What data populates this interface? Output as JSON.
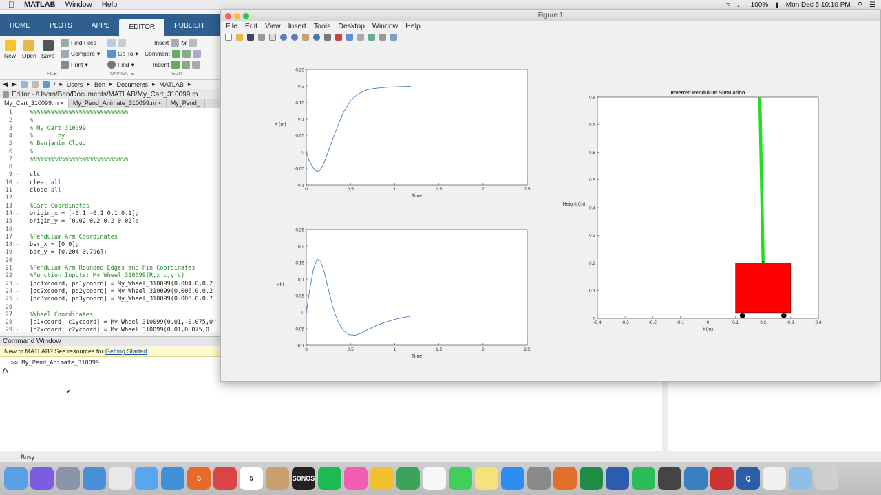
{
  "menubar": {
    "app": "MATLAB",
    "items": [
      "Window",
      "Help"
    ],
    "battery": "100%",
    "datetime": "Mon Dec 5  10:10 PM"
  },
  "toolstrip": {
    "tabs": [
      "HOME",
      "PLOTS",
      "APPS",
      "EDITOR",
      "PUBLISH"
    ],
    "active_tab": "EDITOR",
    "buttons": {
      "new": "New",
      "open": "Open",
      "save": "Save",
      "find_files": "Find Files",
      "compare": "Compare",
      "print": "Print",
      "go_to": "Go To",
      "find": "Find",
      "insert": "Insert",
      "comment": "Comment",
      "indent": "Indent",
      "fx": "fx"
    },
    "groups": {
      "file": "FILE",
      "navigate": "NAVIGATE",
      "edit": "EDIT"
    }
  },
  "address": {
    "crumbs": [
      "/",
      "Users",
      "Ben",
      "Documents",
      "MATLAB"
    ]
  },
  "editor": {
    "title": "Editor - /Users/Ben/Documents/MATLAB/My_Cart_310099.m",
    "tabs": [
      "My_Cart_310099.m",
      "My_Pend_Animate_310099.m",
      "My_Pend_"
    ],
    "lines": [
      {
        "n": "1",
        "d": "",
        "parts": [
          {
            "c": "cm",
            "t": "%%%%%%%%%%%%%%%%%%%%%%%%%%%%"
          }
        ]
      },
      {
        "n": "2",
        "d": "",
        "parts": [
          {
            "c": "cm",
            "t": "%"
          }
        ]
      },
      {
        "n": "3",
        "d": "",
        "parts": [
          {
            "c": "cm",
            "t": "% My_Cart_310099"
          }
        ]
      },
      {
        "n": "4",
        "d": "",
        "parts": [
          {
            "c": "cm",
            "t": "%       by"
          }
        ]
      },
      {
        "n": "5",
        "d": "",
        "parts": [
          {
            "c": "cm",
            "t": "% Benjamin Cloud"
          }
        ]
      },
      {
        "n": "6",
        "d": "",
        "parts": [
          {
            "c": "cm",
            "t": "%"
          }
        ]
      },
      {
        "n": "7",
        "d": "",
        "parts": [
          {
            "c": "cm",
            "t": "%%%%%%%%%%%%%%%%%%%%%%%%%%%%"
          }
        ]
      },
      {
        "n": "8",
        "d": "",
        "parts": []
      },
      {
        "n": "9",
        "d": "-",
        "parts": [
          {
            "c": "",
            "t": "clc"
          }
        ]
      },
      {
        "n": "10",
        "d": "-",
        "parts": [
          {
            "c": "",
            "t": "clear "
          },
          {
            "c": "kw",
            "t": "all"
          }
        ]
      },
      {
        "n": "11",
        "d": "-",
        "parts": [
          {
            "c": "",
            "t": "close "
          },
          {
            "c": "kw",
            "t": "all"
          }
        ]
      },
      {
        "n": "12",
        "d": "",
        "parts": []
      },
      {
        "n": "13",
        "d": "",
        "parts": [
          {
            "c": "cm",
            "t": "%Cart Coordinates"
          }
        ]
      },
      {
        "n": "14",
        "d": "-",
        "parts": [
          {
            "c": "",
            "t": "origin_x = [-0.1 -0.1 0.1 0.1];"
          }
        ]
      },
      {
        "n": "15",
        "d": "-",
        "parts": [
          {
            "c": "",
            "t": "origin_y = [0.02 0.2 0.2 0.02];"
          }
        ]
      },
      {
        "n": "16",
        "d": "",
        "parts": []
      },
      {
        "n": "17",
        "d": "",
        "parts": [
          {
            "c": "cm",
            "t": "%Pendulum Arm Coordinates"
          }
        ]
      },
      {
        "n": "18",
        "d": "-",
        "parts": [
          {
            "c": "",
            "t": "bar_x = [0 0];"
          }
        ]
      },
      {
        "n": "19",
        "d": "-",
        "parts": [
          {
            "c": "",
            "t": "bar_y = [0.204 0.796];"
          }
        ]
      },
      {
        "n": "20",
        "d": "",
        "parts": []
      },
      {
        "n": "21",
        "d": "",
        "parts": [
          {
            "c": "cm",
            "t": "%Pendulum Arm Rounded Edges and Pin Coordinates"
          }
        ]
      },
      {
        "n": "22",
        "d": "",
        "parts": [
          {
            "c": "cm",
            "t": "%Function Inputs: My_Wheel_310099(R,x_c,y_c)"
          }
        ]
      },
      {
        "n": "23",
        "d": "-",
        "parts": [
          {
            "c": "",
            "t": "[pc1xcoord, pc1ycoord] = My_Wheel_310099(0.004,0,0.2"
          }
        ]
      },
      {
        "n": "24",
        "d": "-",
        "parts": [
          {
            "c": "",
            "t": "[pc2xcoord, pc2ycoord] = My_Wheel_310099(0.006,0,0.2"
          }
        ]
      },
      {
        "n": "25",
        "d": "-",
        "parts": [
          {
            "c": "",
            "t": "[pc3xcoord, pc3ycoord] = My_Wheel_310099(0.006,0,0.7"
          }
        ]
      },
      {
        "n": "26",
        "d": "",
        "parts": []
      },
      {
        "n": "27",
        "d": "",
        "parts": [
          {
            "c": "cm",
            "t": "%Wheel Coordinates"
          }
        ]
      },
      {
        "n": "28",
        "d": "-",
        "parts": [
          {
            "c": "",
            "t": "[c1xcoord, c1ycoord] = My_Wheel_310099(0.01,-0.075,0"
          }
        ]
      },
      {
        "n": "29",
        "d": "-",
        "parts": [
          {
            "c": "",
            "t": "[c2xcoord, c2ycoord] = My_Wheel_310099(0.01,0.075,0"
          }
        ]
      }
    ]
  },
  "command_window": {
    "title": "Command Window",
    "notice_prefix": "New to MATLAB? See resources for ",
    "notice_link": "Getting Started",
    "notice_suffix": ".",
    "prompt": ">> My_Pend_Animate_310099",
    "fx": "fx"
  },
  "status": {
    "text": "Busy"
  },
  "figure": {
    "title": "Figure 1",
    "menu": [
      "File",
      "Edit",
      "View",
      "Insert",
      "Tools",
      "Desktop",
      "Window",
      "Help"
    ]
  },
  "chart_data": [
    {
      "type": "line",
      "xlabel": "Time",
      "ylabel": "X (m)",
      "xlim": [
        0,
        2.5
      ],
      "ylim": [
        -0.1,
        0.25
      ],
      "xticks": [
        "0",
        "0.5",
        "1",
        "1.5",
        "2",
        "2.5"
      ],
      "yticks": [
        "-0.1",
        "-0.05",
        "0",
        "0.05",
        "0.1",
        "0.15",
        "0.2",
        "0.25"
      ],
      "color": "#3f7fbf",
      "x": [
        0,
        0.03,
        0.08,
        0.12,
        0.15,
        0.18,
        0.22,
        0.28,
        0.35,
        0.42,
        0.5,
        0.58,
        0.66,
        0.75,
        0.85,
        0.95,
        1.05,
        1.18
      ],
      "y": [
        0.0,
        -0.025,
        -0.05,
        -0.06,
        -0.057,
        -0.045,
        -0.02,
        0.025,
        0.075,
        0.12,
        0.155,
        0.175,
        0.186,
        0.192,
        0.195,
        0.197,
        0.198,
        0.199
      ]
    },
    {
      "type": "line",
      "xlabel": "Time",
      "ylabel": "Phi",
      "xlim": [
        0,
        2.5
      ],
      "ylim": [
        -0.1,
        0.25
      ],
      "xticks": [
        "0",
        "0.5",
        "1",
        "1.5",
        "2",
        "2.5"
      ],
      "yticks": [
        "-0.1",
        "-0.05",
        "0",
        "0.05",
        "0.1",
        "0.15",
        "0.2",
        "0.25"
      ],
      "color": "#3f7fbf",
      "x": [
        0,
        0.04,
        0.08,
        0.12,
        0.16,
        0.2,
        0.25,
        0.3,
        0.36,
        0.42,
        0.48,
        0.55,
        0.62,
        0.7,
        0.8,
        0.9,
        1.0,
        1.1,
        1.18
      ],
      "y": [
        0.0,
        0.07,
        0.13,
        0.16,
        0.155,
        0.125,
        0.07,
        0.015,
        -0.03,
        -0.055,
        -0.068,
        -0.07,
        -0.064,
        -0.052,
        -0.04,
        -0.03,
        -0.022,
        -0.016,
        -0.012
      ]
    },
    {
      "type": "scatter",
      "title": "Inverted Pendulum Simulation",
      "xlabel": "X(m)",
      "ylabel": "Height (m)",
      "xlim": [
        -0.4,
        0.4
      ],
      "ylim": [
        0,
        0.8
      ],
      "xticks": [
        "-0.4",
        "-0.3",
        "-0.2",
        "-0.1",
        "0",
        "0.1",
        "0.2",
        "0.3",
        "0.4"
      ],
      "yticks": [
        "0",
        "0.1",
        "0.2",
        "0.3",
        "0.4",
        "0.5",
        "0.6",
        "0.7",
        "0.8"
      ],
      "cart": {
        "x": [
          0.1,
          0.3
        ],
        "y": [
          0.02,
          0.2
        ],
        "color": "#ff0000"
      },
      "wheels": {
        "x": [
          0.125,
          0.275
        ],
        "y": 0.01,
        "color": "#000000"
      },
      "pendulum": {
        "x": [
          0.2,
          0.188
        ],
        "y": [
          0.204,
          0.8
        ],
        "color": "#22dd22"
      }
    }
  ],
  "dock": [
    "Finder",
    "Siri",
    "Launchpad",
    "Preview",
    "Chrome",
    "Messages",
    "Screen",
    "S",
    "Bookmark",
    "5",
    "Contacts",
    "SONOS",
    "Spotify",
    "iTunes",
    "Photos",
    "Photo Booth",
    "Notes",
    "FaceTime",
    "Notes2",
    "App Store",
    "Prefs",
    "MATLAB",
    "Excel",
    "Word",
    "Evernote",
    "Stocks",
    "Monitor",
    "Tool",
    "Q",
    "Docs",
    "Folder",
    "Trash"
  ]
}
